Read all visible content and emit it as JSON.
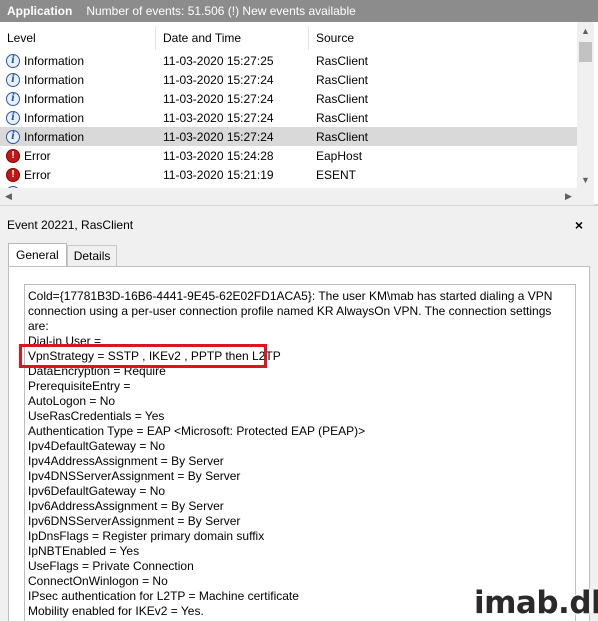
{
  "header": {
    "log_name": "Application",
    "event_count": "Number of events: 51.506 (!) New events available"
  },
  "list": {
    "columns": [
      "Level",
      "Date and Time",
      "Source"
    ],
    "rows": [
      {
        "icon": "information-icon",
        "level": "Information",
        "date": "11-03-2020 15:27:25",
        "source": "RasClient"
      },
      {
        "icon": "information-icon",
        "level": "Information",
        "date": "11-03-2020 15:27:24",
        "source": "RasClient"
      },
      {
        "icon": "information-icon",
        "level": "Information",
        "date": "11-03-2020 15:27:24",
        "source": "RasClient"
      },
      {
        "icon": "information-icon",
        "level": "Information",
        "date": "11-03-2020 15:27:24",
        "source": "RasClient"
      },
      {
        "icon": "information-icon",
        "level": "Information",
        "date": "11-03-2020 15:27:24",
        "source": "RasClient",
        "selected": true
      },
      {
        "icon": "error-icon",
        "level": "Error",
        "date": "11-03-2020 15:24:28",
        "source": "EapHost"
      },
      {
        "icon": "error-icon",
        "level": "Error",
        "date": "11-03-2020 15:21:19",
        "source": "ESENT"
      }
    ]
  },
  "detail": {
    "title": "Event 20221, RasClient",
    "close_glyph": "×",
    "tabs": [
      "General",
      "Details"
    ],
    "active_tab": "General",
    "description_lines": [
      "Cold={17781B3D-16B6-4441-9E45-62E02FD1ACA5}: The user KM\\mab has started dialing a VPN",
      "connection using a per-user connection profile named KR AlwaysOn VPN. The connection settings",
      "are:",
      "Dial-in User =",
      "VpnStrategy = SSTP , IKEv2 , PPTP then L2TP",
      "DataEncryption = Require",
      "PrerequisiteEntry =",
      "AutoLogon = No",
      "UseRasCredentials = Yes",
      "Authentication Type = EAP <Microsoft: Protected EAP (PEAP)>",
      "Ipv4DefaultGateway = No",
      "Ipv4AddressAssignment = By Server",
      "Ipv4DNSServerAssignment = By Server",
      "Ipv6DefaultGateway = No",
      "Ipv6AddressAssignment = By Server",
      "Ipv6DNSServerAssignment = By Server",
      "IpDnsFlags = Register primary domain suffix",
      "IpNBTEnabled = Yes",
      "UseFlags = Private Connection",
      "ConnectOnWinlogon = No",
      "IPsec authentication for L2TP = Machine certificate",
      "Mobility enabled for IKEv2 = Yes."
    ],
    "highlight_color": "#e0141e"
  },
  "watermark": "imab.dk"
}
